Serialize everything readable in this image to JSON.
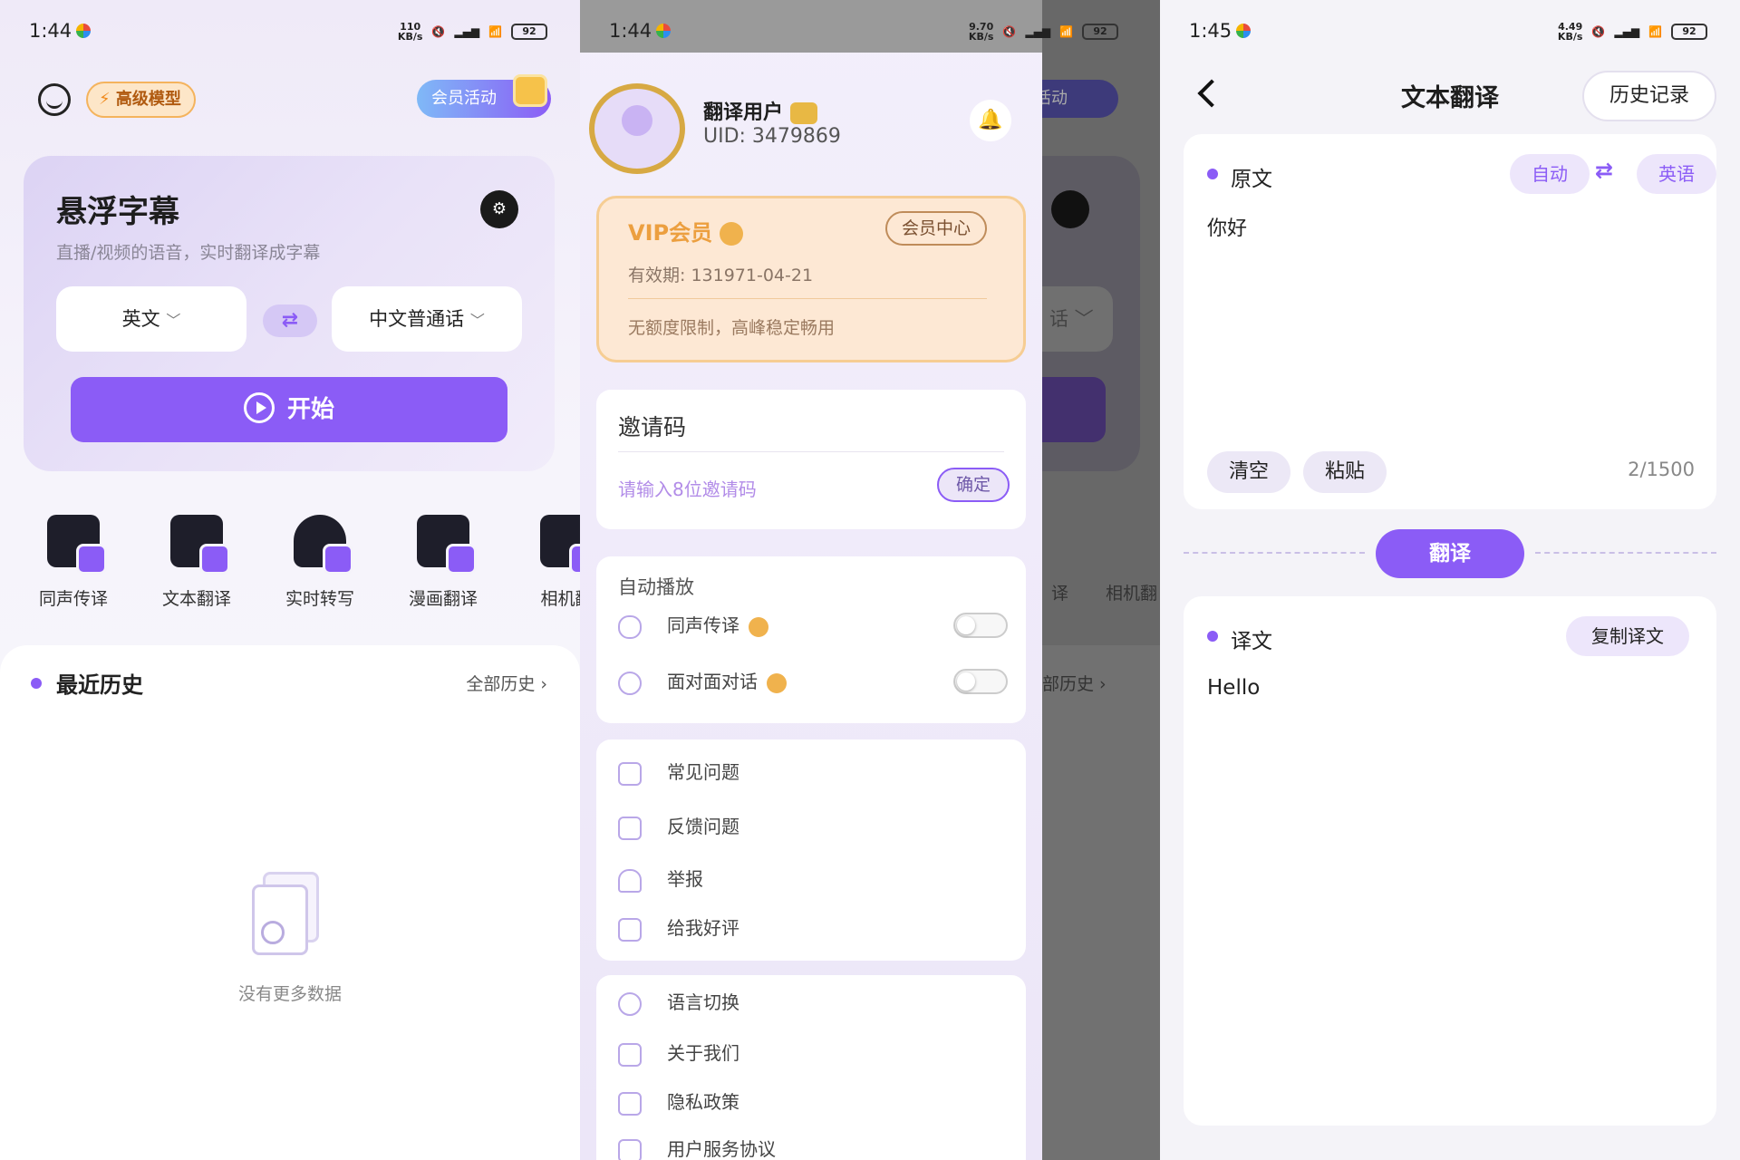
{
  "colors": {
    "accent": "#8b5cf6",
    "gold": "#f0b24d"
  },
  "home": {
    "status": {
      "time": "1:44",
      "net": "110\nKB/s",
      "battery": "92"
    },
    "adv_model": "高级模型",
    "vip_activity": "会员活动",
    "card": {
      "title": "悬浮字幕",
      "subtitle": "直播/视频的语音，实时翻译成字幕",
      "source_lang": "英文",
      "target_lang": "中文普通话",
      "start": "开始"
    },
    "features": [
      {
        "label": "同声传译",
        "icon": "chat-bubble-icon"
      },
      {
        "label": "文本翻译",
        "icon": "document-translate-icon"
      },
      {
        "label": "实时转写",
        "icon": "microphone-transcribe-icon"
      },
      {
        "label": "漫画翻译",
        "icon": "comic-book-icon"
      },
      {
        "label": "相机翻",
        "icon": "camera-icon"
      }
    ],
    "history": {
      "title": "最近历史",
      "all": "全部历史",
      "empty": "没有更多数据"
    }
  },
  "drawer": {
    "status": {
      "time": "1:44",
      "net": "9.70\nKB/s",
      "battery": "92"
    },
    "user": {
      "name": "翻译用户",
      "uid": "UID: 3479869"
    },
    "vip": {
      "title": "VIP会员",
      "center": "会员中心",
      "expiry": "有效期: 131971-04-21",
      "desc": "无额度限制，高峰稳定畅用"
    },
    "invite": {
      "title": "邀请码",
      "placeholder": "请输入8位邀请码",
      "confirm": "确定"
    },
    "autoplay": {
      "title": "自动播放",
      "items": [
        {
          "label": "同声传译",
          "enabled": false
        },
        {
          "label": "面对面对话",
          "enabled": false
        }
      ]
    },
    "menu1": [
      {
        "label": "常见问题",
        "icon": "question-icon"
      },
      {
        "label": "反馈问题",
        "icon": "feedback-icon"
      },
      {
        "label": "举报",
        "icon": "report-bell-icon"
      },
      {
        "label": "给我好评",
        "icon": "thumbs-up-icon"
      }
    ],
    "menu2": [
      {
        "label": "语言切换",
        "icon": "globe-icon"
      },
      {
        "label": "关于我们",
        "icon": "team-icon"
      },
      {
        "label": "隐私政策",
        "icon": "user-lock-icon"
      },
      {
        "label": "用户服务协议",
        "icon": "agreement-icon"
      }
    ],
    "behind": {
      "vip": "活动",
      "hist": "部历史",
      "feature": "译",
      "camera": "相机翻",
      "lang": "话"
    }
  },
  "translate": {
    "status": {
      "time": "1:45",
      "net": "4.49\nKB/s",
      "battery": "92"
    },
    "title": "文本翻译",
    "history": "历史记录",
    "source": {
      "label": "原文",
      "from": "自动",
      "to": "英语",
      "text": "你好",
      "clear": "清空",
      "paste": "粘贴",
      "count": "2/1500"
    },
    "translate_btn": "翻译",
    "result": {
      "label": "译文",
      "copy": "复制译文",
      "text": "Hello"
    }
  }
}
